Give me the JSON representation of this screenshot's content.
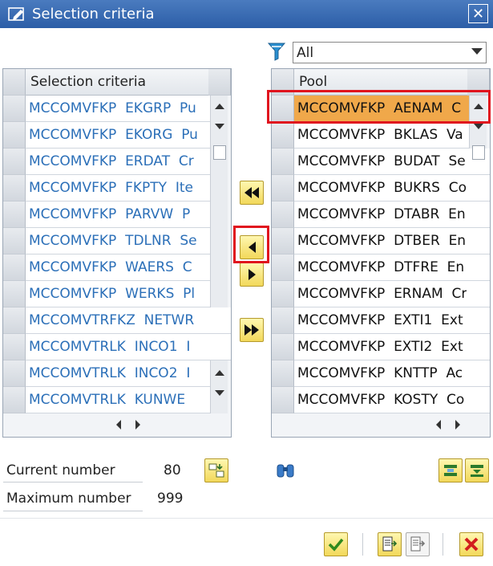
{
  "window": {
    "title": "Selection criteria",
    "close_label": "✕"
  },
  "filter": {
    "value": "All"
  },
  "left_panel": {
    "header": "Selection criteria",
    "rows": [
      "MCCOMVFKP  EKGRP  Pu",
      "MCCOMVFKP  EKORG  Pu",
      "MCCOMVFKP  ERDAT  Cr",
      "MCCOMVFKP  FKPTY  Ite",
      "MCCOMVFKP  PARVW  P",
      "MCCOMVFKP  TDLNR  Se",
      "MCCOMVFKP  WAERS  C",
      "MCCOMVFKP  WERKS  Pl",
      "MCCOMVTRFKZ  NETWR",
      "MCCOMVTRLK  INCO1  I",
      "MCCOMVTRLK  INCO2  I",
      "MCCOMVTRLK  KUNWE"
    ]
  },
  "right_panel": {
    "header": "Pool",
    "rows": [
      "MCCOMVFKP  AENAM  C",
      "MCCOMVFKP  BKLAS  Va",
      "MCCOMVFKP  BUDAT  Se",
      "MCCOMVFKP  BUKRS  Co",
      "MCCOMVFKP  DTABR  En",
      "MCCOMVFKP  DTBER  En",
      "MCCOMVFKP  DTFRE  En",
      "MCCOMVFKP  ERNAM  Cr",
      "MCCOMVFKP  EXTI1  Ext",
      "MCCOMVFKP  EXTI2  Ext",
      "MCCOMVFKP  KNTTP  Ac",
      "MCCOMVFKP  KOSTY  Co"
    ]
  },
  "counts": {
    "current_label": "Current number",
    "current_value": "80",
    "max_label": "Maximum number",
    "max_value": "999"
  },
  "colors": {
    "title_bar": "#2c5ea7",
    "selected_row": "#f0a84a",
    "highlight_box": "#e0141e",
    "link_text": "#2b6fb8"
  }
}
